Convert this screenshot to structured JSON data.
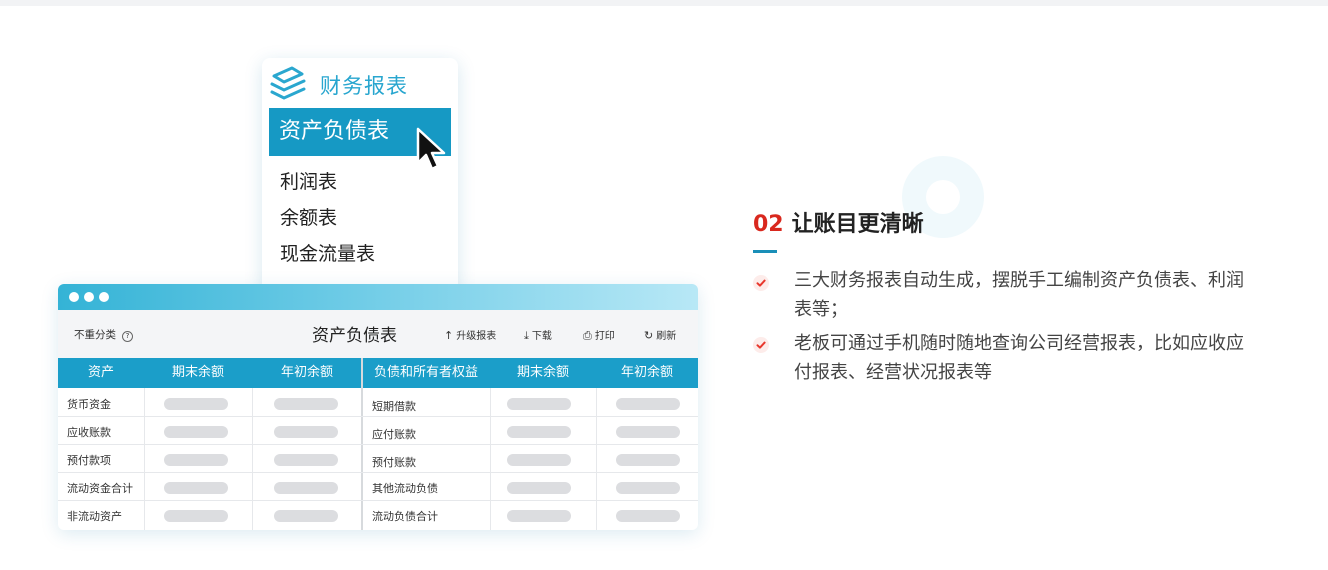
{
  "menu": {
    "title": "财务报表",
    "active_item": "资产负债表",
    "items": [
      "利润表",
      "余额表",
      "现金流量表"
    ]
  },
  "table": {
    "toolbar_left": "不重分类",
    "title": "资产负债表",
    "actions": [
      {
        "icon": "↑",
        "label": "升级报表"
      },
      {
        "icon": "⤓",
        "label": "下载"
      },
      {
        "icon": "⎙",
        "label": "打印"
      },
      {
        "icon": "↻",
        "label": "刷新"
      }
    ],
    "headers": [
      "资产",
      "期末余额",
      "年初余额",
      "负债和所有者权益",
      "期末余额",
      "年初余额"
    ],
    "rows": [
      {
        "asset": "货币资金",
        "liability": "短期借款"
      },
      {
        "asset": "应收账款",
        "liability": "应付账款"
      },
      {
        "asset": "预付款项",
        "liability": "预付账款"
      },
      {
        "asset": "流动资金合计",
        "liability": "其他流动负债"
      },
      {
        "asset": "非流动资产",
        "liability": "流动负债合计"
      }
    ]
  },
  "feature": {
    "number": "02",
    "title": "让账目更清晰",
    "bullets": [
      "三大财务报表自动生成，摆脱手工编制资产负债表、利润表等；",
      "老板可通过手机随时随地查询公司经营报表，比如应收应付报表、经营状况报表等"
    ]
  },
  "colors": {
    "accent_blue": "#1b9ec9",
    "number_red": "#d9281e",
    "check_red": "#e8372c"
  }
}
